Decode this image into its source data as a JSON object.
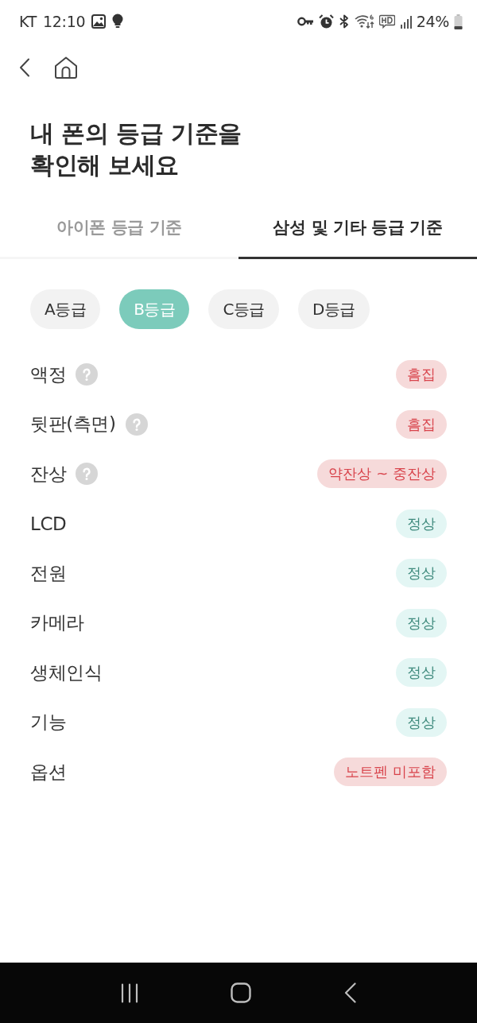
{
  "status_bar": {
    "carrier": "KT",
    "time": "12:10",
    "battery": "24%"
  },
  "title": "내 폰의 등급 기준을\n확인해 보세요",
  "tabs": [
    {
      "label": "아이폰 등급 기준",
      "selected": false
    },
    {
      "label": "삼성 및 기타 등급 기준",
      "selected": true
    }
  ],
  "grades": [
    {
      "label": "A등급",
      "selected": false
    },
    {
      "label": "B등급",
      "selected": true
    },
    {
      "label": "C등급",
      "selected": false
    },
    {
      "label": "D등급",
      "selected": false
    }
  ],
  "criteria": [
    {
      "name": "액정",
      "help": true,
      "badge": {
        "text": "흠집",
        "kind": "defect"
      }
    },
    {
      "name": "뒷판(측면)",
      "help": true,
      "badge": {
        "text": "흠집",
        "kind": "defect"
      }
    },
    {
      "name": "잔상",
      "help": true,
      "badge": {
        "text": "약잔상 ~ 중잔상",
        "kind": "defect"
      }
    },
    {
      "name": "LCD",
      "help": false,
      "badge": {
        "text": "정상",
        "kind": "normal"
      }
    },
    {
      "name": "전원",
      "help": false,
      "badge": {
        "text": "정상",
        "kind": "normal"
      }
    },
    {
      "name": "카메라",
      "help": false,
      "badge": {
        "text": "정상",
        "kind": "normal"
      }
    },
    {
      "name": "생체인식",
      "help": false,
      "badge": {
        "text": "정상",
        "kind": "normal"
      }
    },
    {
      "name": "기능",
      "help": false,
      "badge": {
        "text": "정상",
        "kind": "normal"
      }
    },
    {
      "name": "옵션",
      "help": false,
      "badge": {
        "text": "노트펜 미포함",
        "kind": "defect"
      }
    }
  ]
}
